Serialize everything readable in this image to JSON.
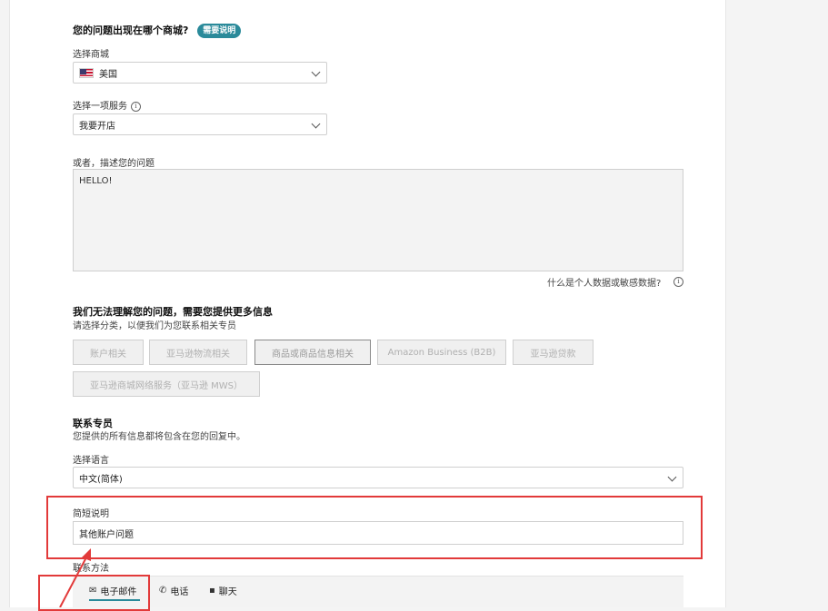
{
  "marketplace": {
    "question": "您的问题出现在哪个商城?",
    "help_badge": "需要说明",
    "select_label": "选择商城",
    "selected": "美国",
    "flag_icon": "us-flag-icon"
  },
  "service": {
    "label": "选择一项服务",
    "selected": "我要开店"
  },
  "description": {
    "label": "或者，描述您的问题",
    "value": "HELLO!",
    "privacy_link": "什么是个人数据或敏感数据?"
  },
  "more_info": {
    "title": "我们无法理解您的问题，需要您提供更多信息",
    "subtitle": "请选择分类，以便我们为您联系相关专员",
    "categories": [
      "账户相关",
      "亚马逊物流相关",
      "商品或商品信息相关",
      "Amazon Business (B2B)",
      "亚马逊贷款",
      "亚马逊商城网络服务（亚马逊 MWS）"
    ]
  },
  "contact": {
    "title": "联系专员",
    "subtitle": "您提供的所有信息都将包含在您的回复中。",
    "language_label": "选择语言",
    "language_selected": "中文(简体)",
    "brief_label": "简短说明",
    "brief_value": "其他账户问题",
    "method_label": "联系方法",
    "methods": [
      {
        "label": "电子邮件",
        "icon": "mail-icon"
      },
      {
        "label": "电话",
        "icon": "phone-icon"
      },
      {
        "label": "聊天",
        "icon": "chat-icon"
      }
    ]
  },
  "colors": {
    "accent": "#2a8a9a",
    "annotation_red": "#e23a3a"
  }
}
